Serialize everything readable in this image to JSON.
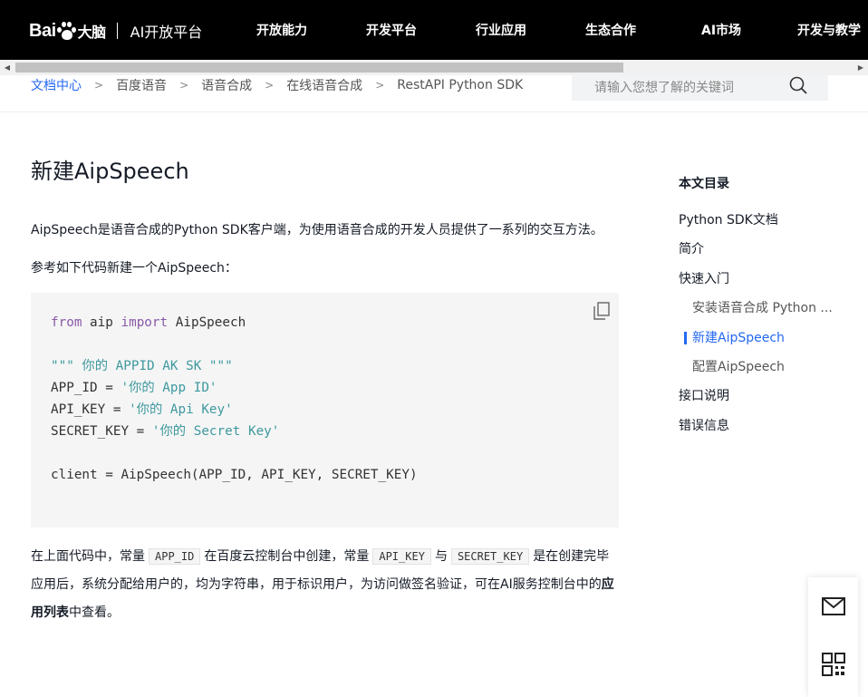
{
  "header": {
    "logo_text": "Bai",
    "logo_du": "大脑",
    "logo_subtitle": "AI开放平台",
    "nav": [
      "开放能力",
      "开发平台",
      "行业应用",
      "生态合作",
      "AI市场",
      "开发与教学"
    ]
  },
  "breadcrumb": [
    "文档中心",
    "百度语音",
    "语音合成",
    "在线语音合成",
    "RestAPI Python SDK"
  ],
  "search": {
    "placeholder": "请输入您想了解的关键词"
  },
  "article": {
    "title": "新建AipSpeech",
    "intro": "AipSpeech是语音合成的Python SDK客户端，为使用语音合成的开发人员提供了一系列的交互方法。",
    "lead": "参考如下代码新建一个AipSpeech：",
    "code": {
      "l1_from": "from",
      "l1_mod": " aip ",
      "l1_import": "import",
      "l1_name": " AipSpeech",
      "l3": "\"\"\" 你的 APPID AK SK \"\"\"",
      "l4_name": "APP_ID = ",
      "l4_val": "'你的 App ID'",
      "l5_name": "API_KEY = ",
      "l5_val": "'你的 Api Key'",
      "l6_name": "SECRET_KEY = ",
      "l6_val": "'你的 Secret Key'",
      "l8": "client = AipSpeech(APP_ID, API_KEY, SECRET_KEY)"
    },
    "note": {
      "t1": "在上面代码中，常量",
      "c1": "APP_ID",
      "t2": "在百度云控制台中创建，常量",
      "c2": "API_KEY",
      "t3": "与",
      "c3": "SECRET_KEY",
      "t4": "是在创建完毕应用后，系统分配给用户的，均为字符串，用于标识用户，为访问做签名验证，可在AI服务控制台中的",
      "strong": "应用列表",
      "t5": "中查看。"
    }
  },
  "toc": {
    "title": "本文目录",
    "items": [
      {
        "label": "Python SDK文档"
      },
      {
        "label": "简介"
      },
      {
        "label": "快速入门"
      },
      {
        "label": "安装语音合成 Python ..."
      },
      {
        "label": "新建AipSpeech"
      },
      {
        "label": "配置AipSpeech"
      },
      {
        "label": "接口说明"
      },
      {
        "label": "错误信息"
      }
    ]
  },
  "side_tools": [
    "mail-icon",
    "qrcode-icon"
  ],
  "colors": {
    "accent": "#2468f2",
    "header_bg": "#000000",
    "code_bg": "#f5f5f5"
  }
}
